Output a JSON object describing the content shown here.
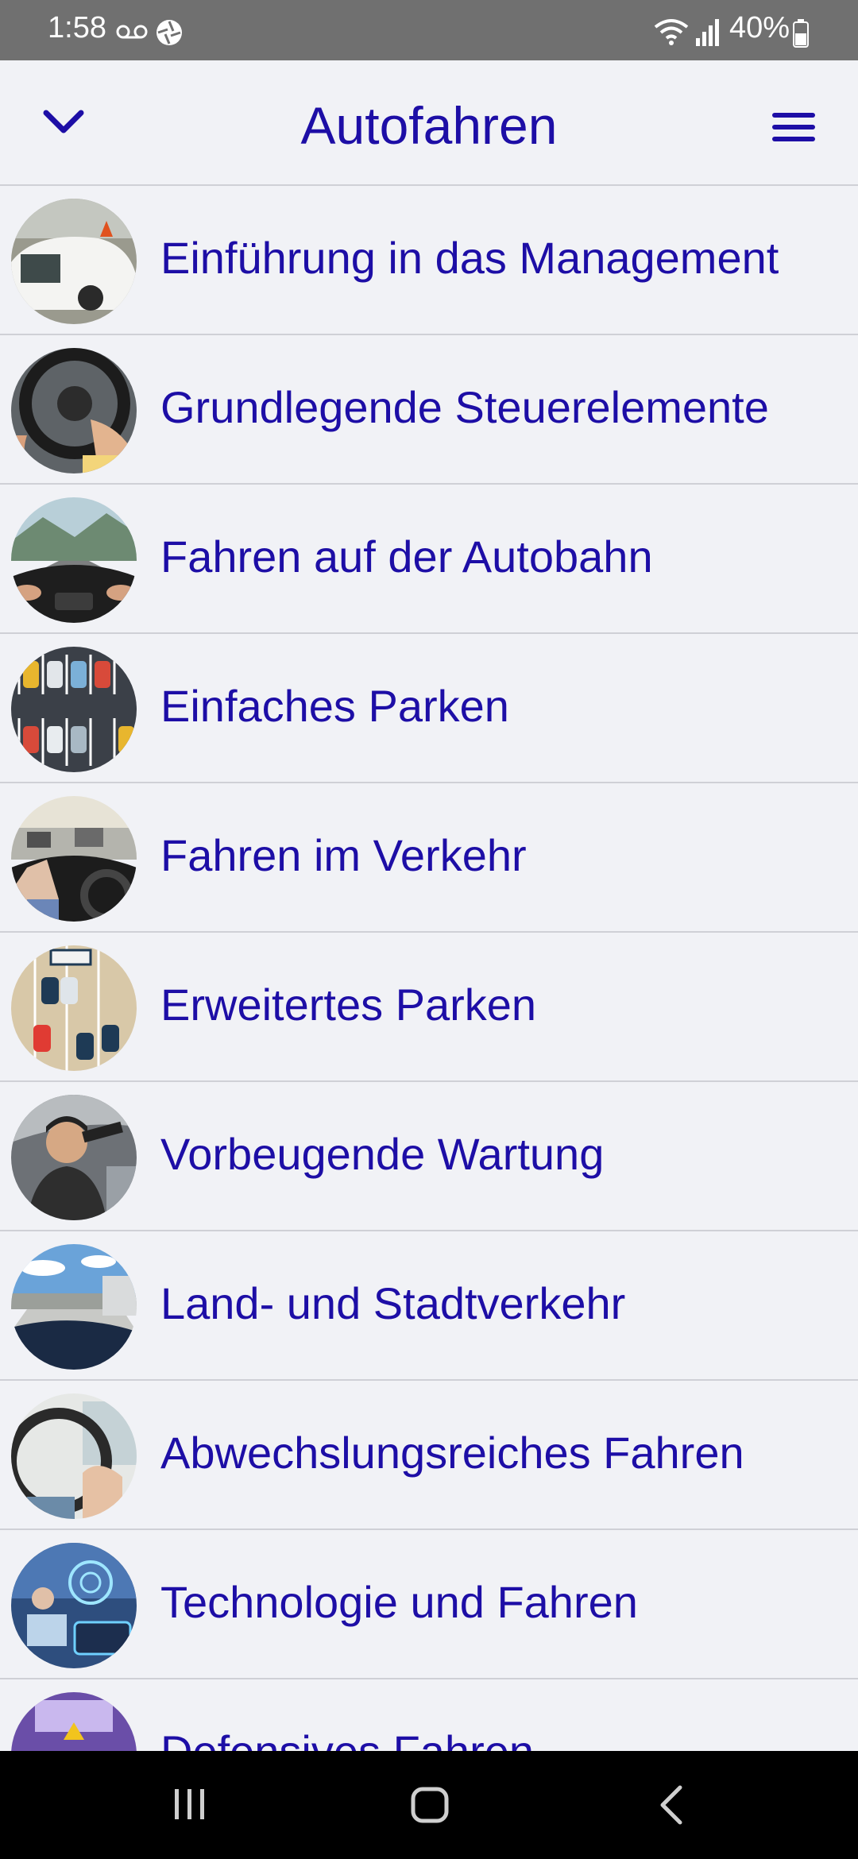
{
  "status_bar": {
    "time": "1:58",
    "battery": "40%",
    "icons": [
      "voicemail-icon",
      "aperture-icon",
      "wifi-icon",
      "signal-icon",
      "battery-icon"
    ]
  },
  "header": {
    "title": "Autofahren",
    "back_icon": "chevron-down-icon",
    "menu_icon": "hamburger-menu-icon"
  },
  "lessons": [
    {
      "title": "Einführung in das Management"
    },
    {
      "title": "Grundlegende Steuerelemente"
    },
    {
      "title": "Fahren auf der Autobahn"
    },
    {
      "title": "Einfaches Parken"
    },
    {
      "title": "Fahren im Verkehr"
    },
    {
      "title": "Erweitertes Parken"
    },
    {
      "title": "Vorbeugende Wartung"
    },
    {
      "title": "Land- und Stadtverkehr"
    },
    {
      "title": "Abwechslungsreiches Fahren"
    },
    {
      "title": "Technologie und Fahren"
    },
    {
      "title": "Defensives Fahren"
    }
  ],
  "nav_bar": {
    "icons": [
      "recent-apps-icon",
      "home-icon",
      "back-icon"
    ]
  },
  "colors": {
    "accent": "#1d0ea6",
    "background": "#f1f2f6",
    "status_bar": "#707070"
  }
}
